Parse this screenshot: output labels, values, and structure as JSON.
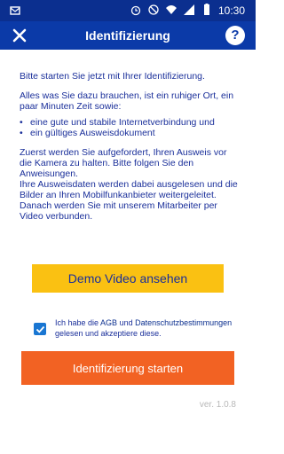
{
  "status_bar": {
    "time": "10:30",
    "icons": [
      "notification-icon",
      "alarm-icon",
      "mute-icon",
      "wifi-icon",
      "signal-icon",
      "battery-icon"
    ]
  },
  "toolbar": {
    "title": "Identifizierung",
    "close_icon": "close-icon",
    "help_label": "?"
  },
  "intro": {
    "p1": "Bitte starten Sie jetzt mit Ihrer Identifizierung.",
    "p2": "Alles was Sie dazu brauchen, ist ein ruhiger Ort, ein paar Minuten Zeit sowie:",
    "bullets": [
      "eine gute und stabile Internetverbindung und",
      "ein gültiges Ausweisdokument"
    ],
    "p3": "Zuerst werden Sie aufgefordert, Ihren Ausweis vor die Kamera zu halten. Bitte folgen Sie den Anweisungen.",
    "p4": "Ihre Ausweisdaten werden dabei ausgelesen und die Bilder an Ihren Mobilfunkanbieter weitergeleitet.",
    "p5": "Danach werden Sie mit unserem Mitarbeiter per Video verbunden."
  },
  "demo_button": "Demo Video ansehen",
  "agb": {
    "checked": true,
    "text_prefix": "Ich habe die ",
    "agb_link": "AGB",
    "text_mid": " und ",
    "privacy_link": "Datenschutzbestimmungen",
    "text_suffix": " gelesen und akzeptiere diese."
  },
  "start_button": "Identifizierung starten",
  "version": "ver. 1.0.8",
  "colors": {
    "status_bar": "#0b2f8f",
    "toolbar": "#0b3aa8",
    "text": "#1a2f9a",
    "demo_button": "#fac112",
    "start_button": "#f26223",
    "checkbox": "#1976d2"
  }
}
